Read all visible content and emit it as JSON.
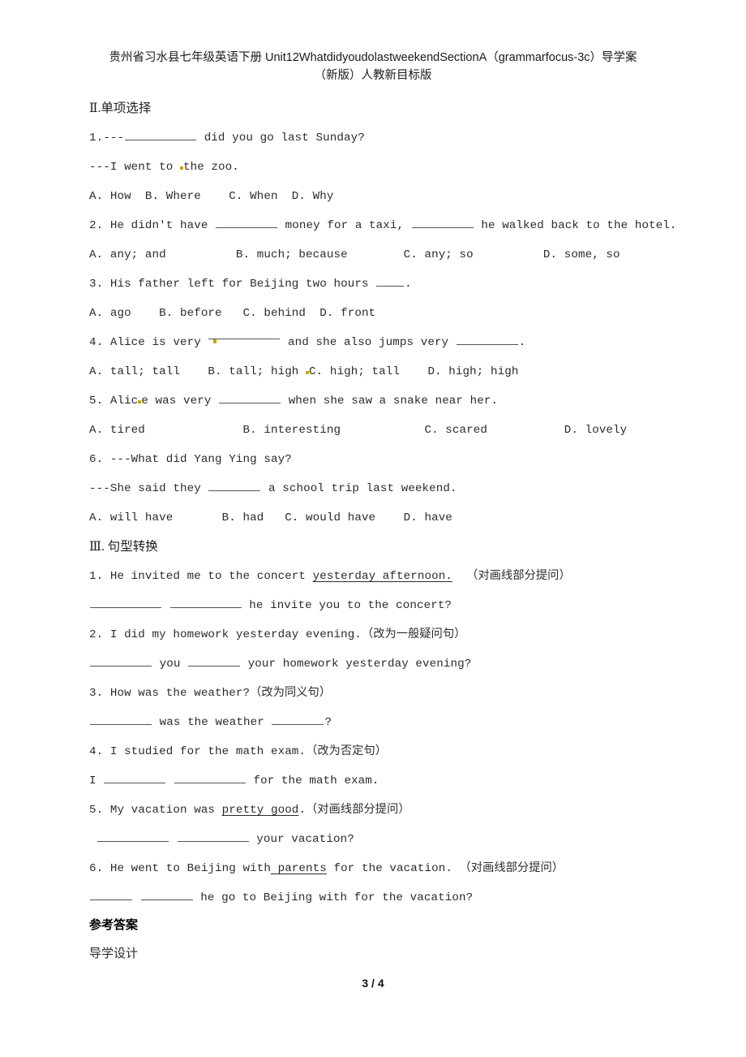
{
  "document": {
    "title_line1": "贵州省习水县七年级英语下册 Unit12WhatdidyoudolastweekendSectionA（grammarfocus-3c）导学案",
    "title_line2": "（新版）人教新目标版"
  },
  "section2": {
    "heading": "Ⅱ.单项选择",
    "q1": {
      "stem_pre": "1.---",
      "stem_post": " did you go last Sunday?",
      "reply_pre": "---I went to ",
      "reply_post": "the zoo.",
      "options": "A. How  B. Where    C. When  D. Why"
    },
    "q2": {
      "stem_pre": "2. He didn't have ",
      "stem_mid": " money for a taxi, ",
      "stem_post": " he walked back to the hotel.",
      "options": "A. any; and          B. much; because        C. any; so          D. some, so"
    },
    "q3": {
      "stem_pre": "3. His father left for Beijing two hours ",
      "stem_post": ".",
      "options": "A. ago    B. before   C. behind  D. front"
    },
    "q4": {
      "stem_pre": "4. Alice is very ",
      "stem_mid": " and she also jumps very ",
      "stem_post": ".",
      "opt_a": "A. tall; tall    B. tall; high ",
      "opt_c": "C. high; tall    D. high; high"
    },
    "q5": {
      "stem_pre": "5. Alic",
      "stem_mid": "e was very ",
      "stem_post": " when she saw a snake near her.",
      "options": "A. tired              B. interesting            C. scared           D. lovely"
    },
    "q6": {
      "stem": "6. ---What did Yang Ying say?",
      "reply_pre": "---She said they ",
      "reply_post": " a school trip last weekend.",
      "options": "A. will have       B. had   C. would have    D. have"
    }
  },
  "section3": {
    "heading": "Ⅲ. 句型转换",
    "q1": {
      "stem_pre": "1. He invited me to the concert ",
      "stem_underlined": "yesterday afternoon.",
      "stem_post": "  （对画线部分提问）",
      "answer_post": " he invite you to the concert?"
    },
    "q2": {
      "stem": "2. I did my homework yesterday evening.（改为一般疑问句）",
      "answer_mid": " you ",
      "answer_post": " your homework yesterday evening?"
    },
    "q3": {
      "stem": "3. How was the weather?（改为同义句）",
      "answer_mid": " was the weather ",
      "answer_post": "?"
    },
    "q4": {
      "stem": "4. I studied for the math exam.（改为否定句）",
      "answer_pre": "I ",
      "answer_post": " for the math exam."
    },
    "q5": {
      "stem_pre": "5. My vacation was ",
      "stem_underlined": "pretty good",
      "stem_post": ".（对画线部分提问）",
      "answer_post": " your vacation?"
    },
    "q6": {
      "stem_pre": "6. He went to Beijing with",
      "stem_underlined": " parents",
      "stem_post": " for the vacation. （对画线部分提问）",
      "answer_post": " he go to Beijing with for the vacation?"
    }
  },
  "answers": {
    "heading": "参考答案",
    "subheading": "导学设计"
  },
  "footer": {
    "page": "3 / 4"
  }
}
